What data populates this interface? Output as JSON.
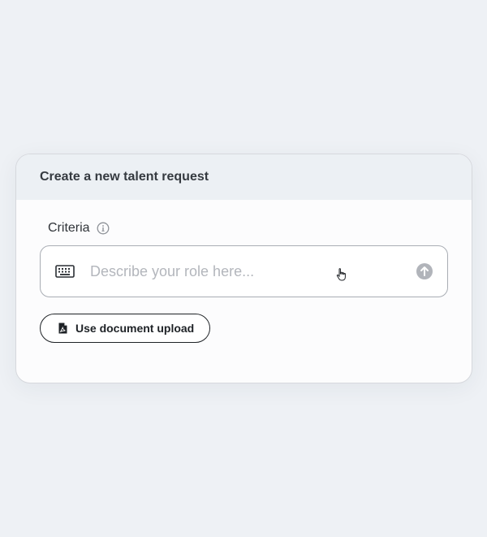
{
  "card": {
    "title": "Create a new talent request"
  },
  "criteria": {
    "label": "Criteria",
    "info_icon": "info-icon",
    "input": {
      "placeholder": "Describe your role here...",
      "value": "",
      "left_icon": "keyboard-icon",
      "submit_icon": "arrow-up-icon"
    }
  },
  "upload": {
    "label": "Use document upload",
    "icon": "document-icon"
  },
  "colors": {
    "background": "#eef1f5",
    "header_bg": "#ecf0f4",
    "card_bg": "#fcfcfd",
    "border": "#a9adb4",
    "text": "#2f3338",
    "placeholder": "#b3b6bc",
    "submit_disabled": "#b1b4ba"
  }
}
